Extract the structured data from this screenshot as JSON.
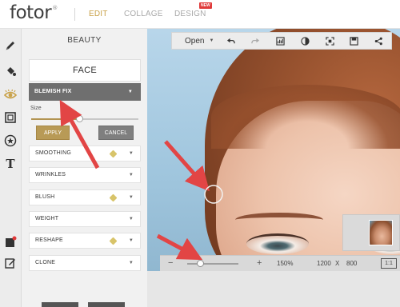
{
  "app": {
    "logo": "fotor",
    "logo_mark": "®",
    "nav": {
      "edit": "EDIT",
      "collage": "COLLAGE",
      "design": "DESIGN",
      "new_badge": "NEW"
    }
  },
  "toolbar": {
    "icons": [
      "pencil-icon",
      "paint-bucket-icon",
      "eye-icon",
      "frame-icon",
      "sticker-star-icon",
      "text-icon",
      "flag-icon",
      "edit-note-icon"
    ],
    "text_tool_label": "T"
  },
  "panel": {
    "title": "BEAUTY",
    "face_label": "FACE",
    "blemish_label": "BLEMISH FIX",
    "size_label": "Size",
    "size_value": 0.45,
    "apply_label": "APPLY",
    "cancel_label": "CANCEL",
    "features": [
      {
        "label": "SMOOTHING",
        "premium": true
      },
      {
        "label": "WRINKLES",
        "premium": false
      },
      {
        "label": "BLUSH",
        "premium": true
      },
      {
        "label": "WEIGHT",
        "premium": false
      },
      {
        "label": "RESHAPE",
        "premium": true
      },
      {
        "label": "CLONE",
        "premium": false
      }
    ]
  },
  "image_toolbar": {
    "open_label": "Open",
    "icons": [
      "undo-icon",
      "redo-icon",
      "histogram-icon",
      "compare-icon",
      "fit-screen-icon",
      "save-icon",
      "share-icon"
    ]
  },
  "zoom_bar": {
    "minus": "−",
    "plus": "+",
    "zoom_value": 0.25,
    "zoom_percent": "150%",
    "width": "1200",
    "x": "X",
    "height": "800",
    "one_to_one": "1:1"
  },
  "colors": {
    "accent": "#b89a56",
    "active_tab": "#c9a24a",
    "annotation_arrow": "#e24545"
  }
}
